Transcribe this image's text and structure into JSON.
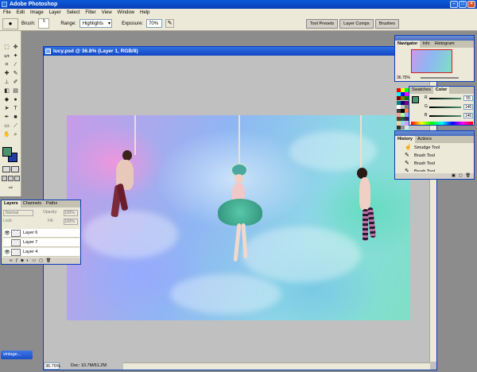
{
  "app": {
    "title": "Adobe Photoshop"
  },
  "menu": [
    "File",
    "Edit",
    "Image",
    "Layer",
    "Select",
    "Filter",
    "View",
    "Window",
    "Help"
  ],
  "options": {
    "brush_label": "Brush:",
    "brush_size": "5",
    "range_label": "Range:",
    "range_value": "Highlights",
    "exposure_label": "Exposure:",
    "exposure_value": "70%"
  },
  "palette_well": [
    "Tool Presets",
    "Layer Comps",
    "Brushes"
  ],
  "document": {
    "title": "lucy.psd @ 36.8% (Layer 1, RGB/8)",
    "zoom": "36.75%",
    "doc_info": "Doc: 10.7M/61.2M"
  },
  "navigator": {
    "tabs": [
      "Navigator",
      "Info",
      "Histogram"
    ],
    "zoom": "36.75%"
  },
  "color": {
    "tabs": [
      "Swatches",
      "Color"
    ],
    "r": "55",
    "g": "146",
    "b": "146"
  },
  "history": {
    "tabs": [
      "History",
      "Actions"
    ],
    "items": [
      "Smudge Tool",
      "Brush Tool",
      "Brush Tool",
      "Brush Tool"
    ]
  },
  "layers": {
    "tabs": [
      "Layers",
      "Channels",
      "Paths"
    ],
    "blend": "Normal",
    "opacity_label": "Opacity:",
    "opacity": "100%",
    "lock_label": "Lock:",
    "fill_label": "Fill:",
    "fill": "100%",
    "rows": [
      "Layer 6",
      "Layer 7",
      "Layer 4"
    ]
  },
  "taskbar": {
    "item": "vintage..."
  },
  "colors": {
    "foreground": "#4a9270",
    "background": "#1f3ea8",
    "title_blue": "#0b3fb8"
  }
}
